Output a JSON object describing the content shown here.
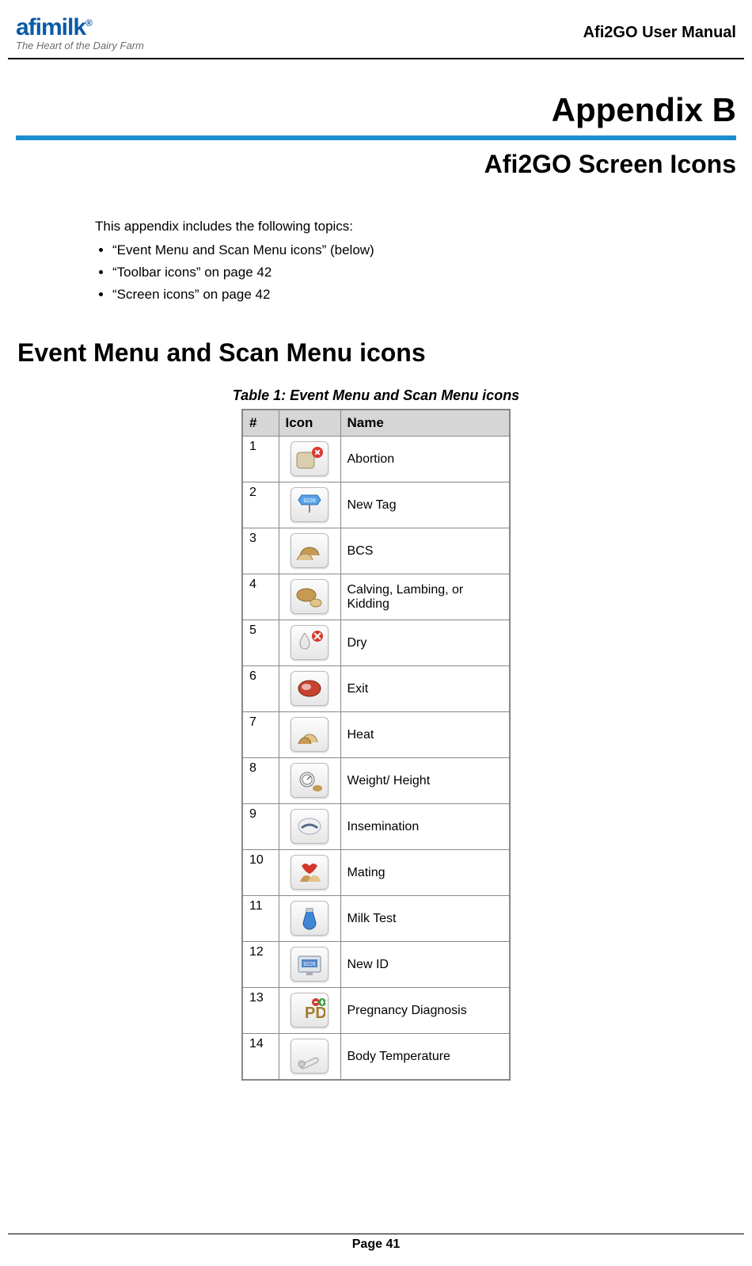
{
  "header": {
    "logo_brand": "afimilk",
    "logo_tagline": "The Heart of the Dairy Farm",
    "doc_title": "Afi2GO User Manual"
  },
  "appendix_label": "Appendix B",
  "subtitle": "Afi2GO Screen Icons",
  "intro": "This appendix includes the following topics:",
  "bullets": [
    "“Event Menu and Scan Menu icons” (below)",
    "“Toolbar icons” on page 42",
    "“Screen icons” on page 42"
  ],
  "section_heading": "Event Menu and Scan Menu icons",
  "table_caption": "Table 1: Event Menu and Scan Menu icons",
  "table": {
    "headers": {
      "num": "#",
      "icon": "Icon",
      "name": "Name"
    },
    "rows": [
      {
        "num": "1",
        "icon": "abortion-icon",
        "name": "Abortion"
      },
      {
        "num": "2",
        "icon": "new-tag-icon",
        "name": "New Tag"
      },
      {
        "num": "3",
        "icon": "bcs-icon",
        "name": "BCS"
      },
      {
        "num": "4",
        "icon": "calving-icon",
        "name": "Calving, Lambing, or Kidding"
      },
      {
        "num": "5",
        "icon": "dry-icon",
        "name": "Dry"
      },
      {
        "num": "6",
        "icon": "exit-icon",
        "name": "Exit"
      },
      {
        "num": "7",
        "icon": "heat-icon",
        "name": "Heat"
      },
      {
        "num": "8",
        "icon": "weight-height-icon",
        "name": "Weight/ Height"
      },
      {
        "num": "9",
        "icon": "insemination-icon",
        "name": "Insemination"
      },
      {
        "num": "10",
        "icon": "mating-icon",
        "name": "Mating"
      },
      {
        "num": "11",
        "icon": "milk-test-icon",
        "name": "Milk Test"
      },
      {
        "num": "12",
        "icon": "new-id-icon",
        "name": "New ID"
      },
      {
        "num": "13",
        "icon": "pregnancy-diagnosis-icon",
        "name": "Pregnancy Diagnosis"
      },
      {
        "num": "14",
        "icon": "body-temperature-icon",
        "name": "Body Temperature"
      }
    ]
  },
  "footer": {
    "page_label": "Page 41"
  }
}
